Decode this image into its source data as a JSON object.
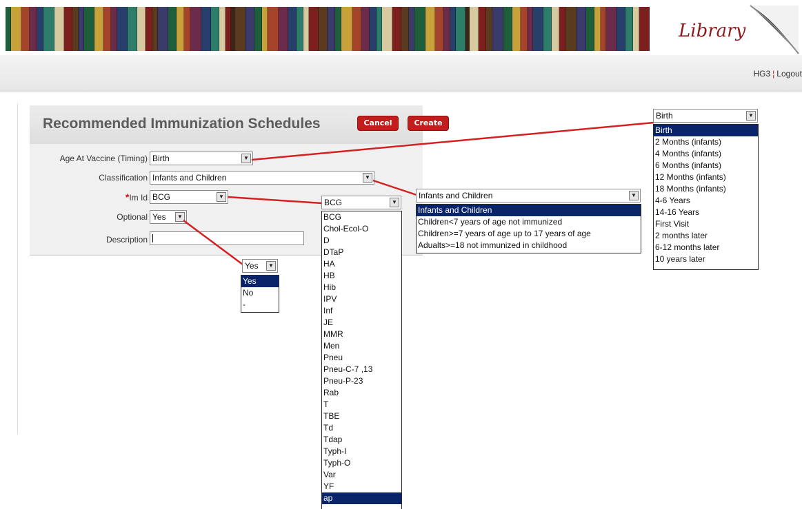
{
  "header": {
    "brand": "Library",
    "user": "HG3",
    "logout": "Logout"
  },
  "form": {
    "title": "Recommended Immunization Schedules",
    "cancel_label": "Cancel",
    "create_label": "Create",
    "age_label": "Age At Vaccine (Timing)",
    "age_value": "Birth",
    "classification_label": "Classification",
    "classification_value": "Infants and Children",
    "required_mark": "*",
    "imid_label": "Im Id",
    "imid_value": "BCG",
    "optional_label": "Optional",
    "optional_value": "Yes",
    "description_label": "Description",
    "description_value": ""
  },
  "age_dropdown": {
    "value": "Birth",
    "options": [
      "Birth",
      "2 Months (infants)",
      "4 Months (infants)",
      "6 Months (infants)",
      "12 Months (infants)",
      "18 Months (infants)",
      "4-6 Years",
      "14-16 Years",
      "First Visit",
      "2 months later",
      "6-12 months later",
      "10 years later"
    ],
    "selected_index": 0
  },
  "classification_dropdown": {
    "value": "Infants and Children",
    "options": [
      "Infants and Children",
      "Children<7 years of age not immunized",
      "Children>=7 years of age up to 17 years of age",
      "Adualts>=18 not immunized in childhood"
    ],
    "selected_index": 0
  },
  "imid_dropdown": {
    "value": "BCG",
    "options": [
      "BCG",
      "Chol-Ecol-O",
      "D",
      "DTaP",
      "HA",
      "HB",
      "Hib",
      "IPV",
      "Inf",
      "JE",
      "MMR",
      "Men",
      "Pneu",
      "Pneu-C-7 ,13",
      "Pneu-P-23",
      "Rab",
      "T",
      "TBE",
      "Td",
      "Tdap",
      "Typh-I",
      "Typh-O",
      "Var",
      "YF",
      "ap"
    ],
    "selected_index": 24
  },
  "optional_dropdown": {
    "value": "Yes",
    "options": [
      "Yes",
      "No",
      "-"
    ],
    "selected_index": 0
  },
  "colors": {
    "accent": "#c21d1d",
    "selection": "#0a246a",
    "connector": "#d42020"
  }
}
